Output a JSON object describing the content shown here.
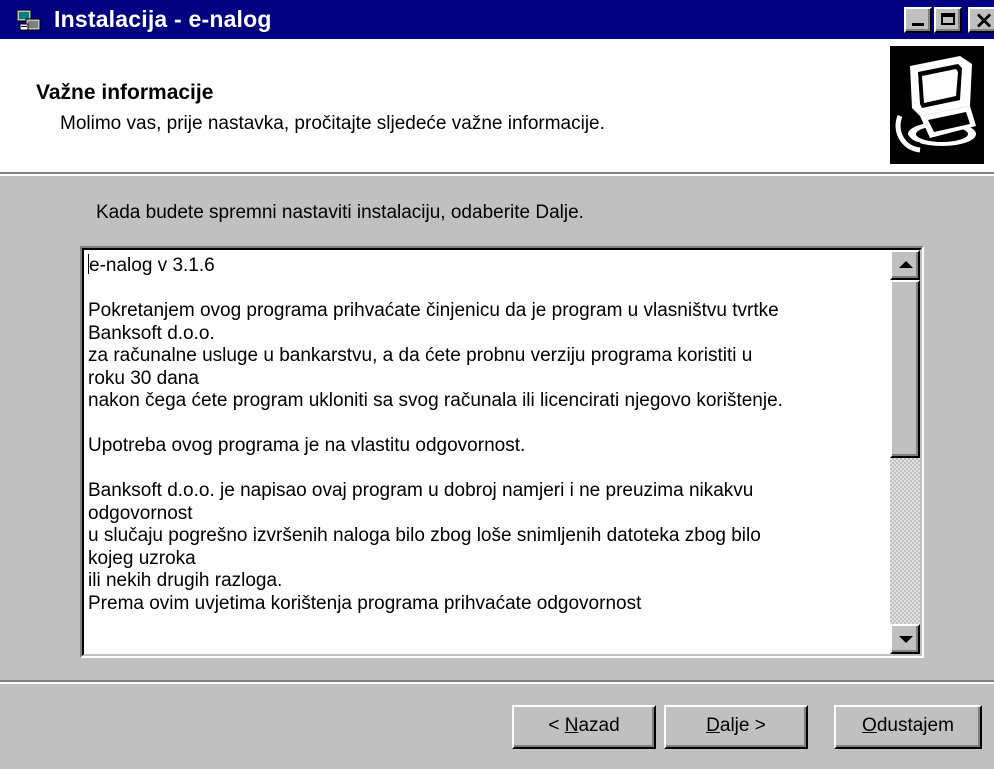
{
  "window": {
    "title": "Instalacija - e-nalog",
    "title_icon": "installer-icon",
    "controls": {
      "minimize_icon": "minimize-icon",
      "maximize_icon": "maximize-icon",
      "close_icon": "close-icon",
      "close_glyph": "×"
    }
  },
  "header": {
    "title": "Važne informacije",
    "subtitle": "Molimo vas, prije nastavka, pročitajte sljedeće važne informacije.",
    "image_icon": "computer-install-icon"
  },
  "instruction": "Kada budete spremni nastaviti instalaciju, odaberite Dalje.",
  "memo": {
    "lines": [
      "e-nalog v 3.1.6",
      "",
      "Pokretanjem ovog programa prihvaćate činjenicu da je program u vlasništvu tvrtke",
      "Banksoft d.o.o.",
      "za računalne usluge u bankarstvu, a da ćete probnu verziju programa koristiti u",
      "roku 30 dana",
      "nakon čega ćete program ukloniti sa svog računala ili licencirati njegovo korištenje.",
      "",
      "Upotreba ovog programa je na vlastitu odgovornost.",
      "",
      "Banksoft d.o.o. je napisao ovaj program u dobroj namjeri i ne preuzima nikakvu",
      "odgovornost",
      "u slučaju pogrešno izvršenih naloga bilo zbog loše snimljenih datoteka zbog bilo",
      "kojeg uzroka",
      "ili nekih drugih razloga.",
      "Prema ovim uvjetima korištenja programa prihvaćate odgovornost"
    ],
    "scroll_position": 0.0,
    "scroll_up_icon": "scroll-up-arrow-icon",
    "scroll_down_icon": "scroll-down-arrow-icon"
  },
  "buttons": {
    "back": {
      "prefix": "< ",
      "accel": "N",
      "rest": "azad"
    },
    "next": {
      "accel": "D",
      "rest": "alje >"
    },
    "cancel": {
      "accel": "O",
      "rest": "dustajem"
    }
  },
  "colors": {
    "titlebar": "#000080",
    "face": "#c0c0c0",
    "header_bg": "#ffffff"
  }
}
